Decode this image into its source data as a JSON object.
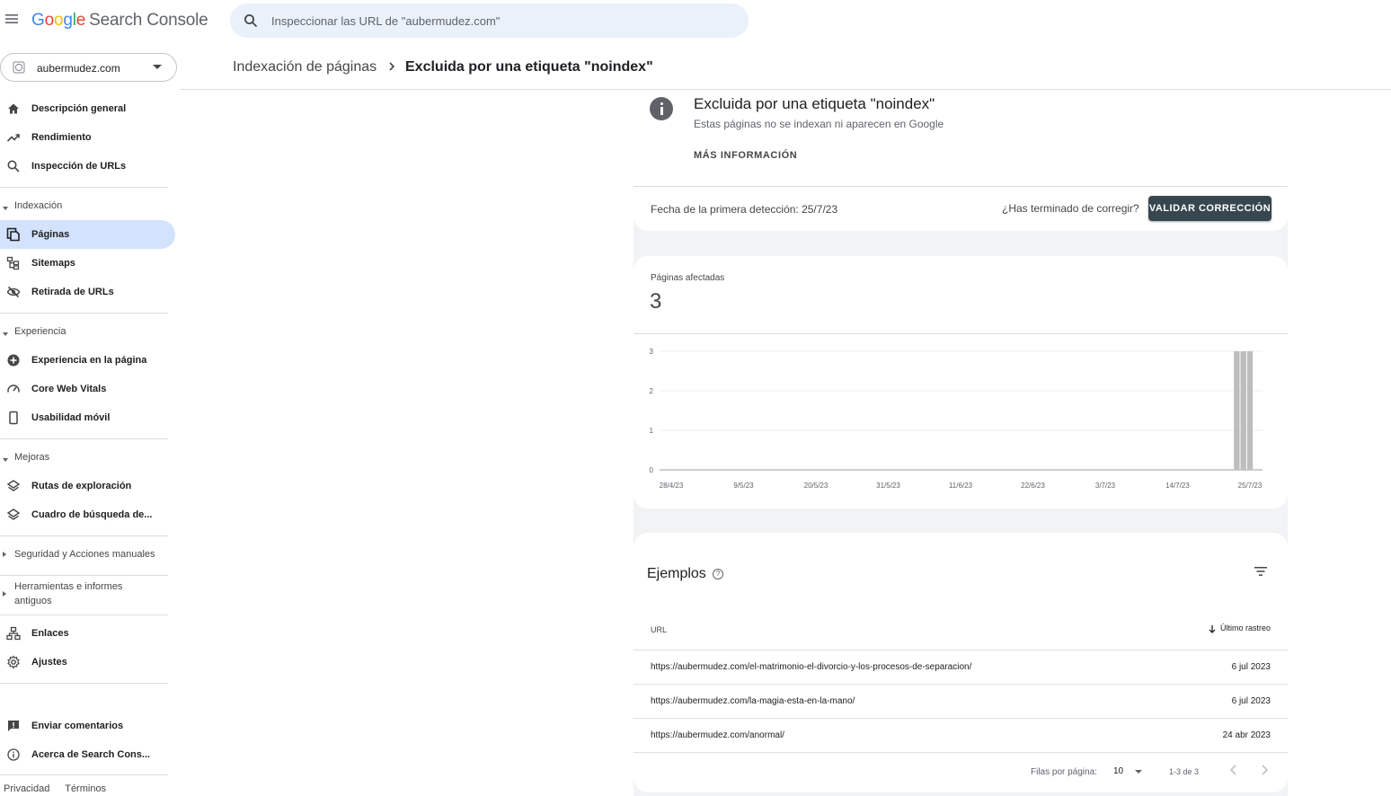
{
  "app": {
    "logo_letters": [
      "G",
      "o",
      "o",
      "g",
      "l",
      "e"
    ],
    "logo_suffix": "Search Console"
  },
  "search": {
    "placeholder": "Inspeccionar las URL de \"aubermudez.com\""
  },
  "property": {
    "name": "aubermudez.com"
  },
  "sidebar": {
    "top_items": [
      {
        "label": "Descripción general",
        "icon": "home-icon"
      },
      {
        "label": "Rendimiento",
        "icon": "trending-up-icon"
      },
      {
        "label": "Inspección de URLs",
        "icon": "search-icon"
      }
    ],
    "indexacion": {
      "label": "Indexación",
      "items": [
        {
          "label": "Páginas",
          "icon": "pages-icon",
          "active": true
        },
        {
          "label": "Sitemaps",
          "icon": "sitemap-icon"
        },
        {
          "label": "Retirada de URLs",
          "icon": "eye-off-icon"
        }
      ]
    },
    "experiencia": {
      "label": "Experiencia",
      "items": [
        {
          "label": "Experiencia en la página",
          "icon": "plus-circle-icon"
        },
        {
          "label": "Core Web Vitals",
          "icon": "speedometer-icon"
        },
        {
          "label": "Usabilidad móvil",
          "icon": "phone-icon"
        }
      ]
    },
    "mejoras": {
      "label": "Mejoras",
      "items": [
        {
          "label": "Rutas de exploración",
          "icon": "layers-icon"
        },
        {
          "label": "Cuadro de búsqueda de...",
          "icon": "layers-icon"
        }
      ]
    },
    "seguridad": {
      "label": "Seguridad y Acciones manuales"
    },
    "herramientas": {
      "label_line1": "Herramientas e informes",
      "label_line2": "antiguos"
    },
    "bottom_items": [
      {
        "label": "Enlaces",
        "icon": "links-icon"
      },
      {
        "label": "Ajustes",
        "icon": "gear-icon"
      }
    ],
    "footer_items": [
      {
        "label": "Enviar comentarios",
        "icon": "feedback-icon"
      },
      {
        "label": "Acerca de Search Cons...",
        "icon": "info-outline-icon"
      }
    ],
    "links": {
      "privacy": "Privacidad",
      "terms": "Términos"
    }
  },
  "breadcrumb": {
    "parent": "Indexación de páginas",
    "current": "Excluida por una etiqueta \"noindex\""
  },
  "issue": {
    "title": "Excluida por una etiqueta \"noindex\"",
    "subtitle": "Estas páginas no se indexan ni aparecen en Google",
    "more_info": "MÁS INFORMACIÓN",
    "first_detected": "Fecha de la primera detección: 25/7/23",
    "question": "¿Has terminado de corregir?",
    "validate_button": "VALIDAR CORRECCIÓN"
  },
  "affected": {
    "label": "Páginas afectadas",
    "count": "3"
  },
  "chart_data": {
    "type": "bar",
    "x_tick_labels": [
      "28/4/23",
      "9/5/23",
      "20/5/23",
      "31/5/23",
      "11/6/23",
      "22/6/23",
      "3/7/23",
      "14/7/23",
      "25/7/23"
    ],
    "y_tick_labels": [
      "0",
      "1",
      "2",
      "3"
    ],
    "ylim": [
      0,
      3
    ],
    "grid": true,
    "bar_color": "#bdbdbd",
    "series": [
      {
        "values": [
          {
            "x": "23/7/23",
            "y": 3
          },
          {
            "x": "24/7/23",
            "y": 3
          },
          {
            "x": "25/7/23",
            "y": 3
          }
        ]
      }
    ]
  },
  "examples": {
    "title": "Ejemplos",
    "col_url": "URL",
    "col_date": "Último rastreo",
    "rows": [
      {
        "url": "https://aubermudez.com/el-matrimonio-el-divorcio-y-los-procesos-de-separacion/",
        "date": "6 jul 2023"
      },
      {
        "url": "https://aubermudez.com/la-magia-esta-en-la-mano/",
        "date": "6 jul 2023"
      },
      {
        "url": "https://aubermudez.com/anormal/",
        "date": "24 abr 2023"
      }
    ],
    "pagination": {
      "rows_label": "Filas por página:",
      "rows_value": "10",
      "range": "1-3 de 3"
    }
  }
}
